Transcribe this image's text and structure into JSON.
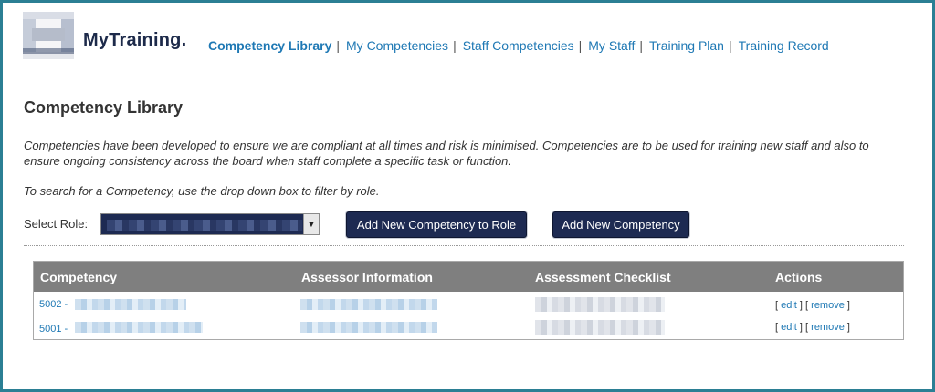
{
  "header": {
    "brand": "MyTraining."
  },
  "nav": {
    "items": [
      {
        "label": "Competency Library",
        "active": true
      },
      {
        "label": "My Competencies"
      },
      {
        "label": "Staff Competencies"
      },
      {
        "label": "My Staff"
      },
      {
        "label": "Training Plan"
      },
      {
        "label": "Training Record"
      }
    ],
    "separator": "|"
  },
  "page": {
    "title": "Competency Library",
    "intro": "Competencies have been developed to ensure we are compliant at all times and risk is minimised. Competencies are to be used for training new staff and also to ensure ongoing consistency across the board when staff complete a specific task or function.",
    "hint": "To search for a Competency, use the drop down box to filter by role."
  },
  "filter": {
    "label": "Select Role:",
    "dropdown_icon": "chevron-down-icon"
  },
  "buttons": {
    "add_to_role": "Add New Competency to Role",
    "add_new": "Add New Competency"
  },
  "table": {
    "headers": [
      "Competency",
      "Assessor Information",
      "Assessment Checklist",
      "Actions"
    ],
    "rows": [
      {
        "id_prefix": "5002 -",
        "edit": "edit",
        "remove": "remove"
      },
      {
        "id_prefix": "5001 -",
        "edit": "edit",
        "remove": "remove"
      }
    ]
  },
  "colors": {
    "accent": "#1e78b4",
    "button_bg": "#1d2a52",
    "header_bg": "#7f7f7f",
    "frame": "#2b7f94"
  }
}
